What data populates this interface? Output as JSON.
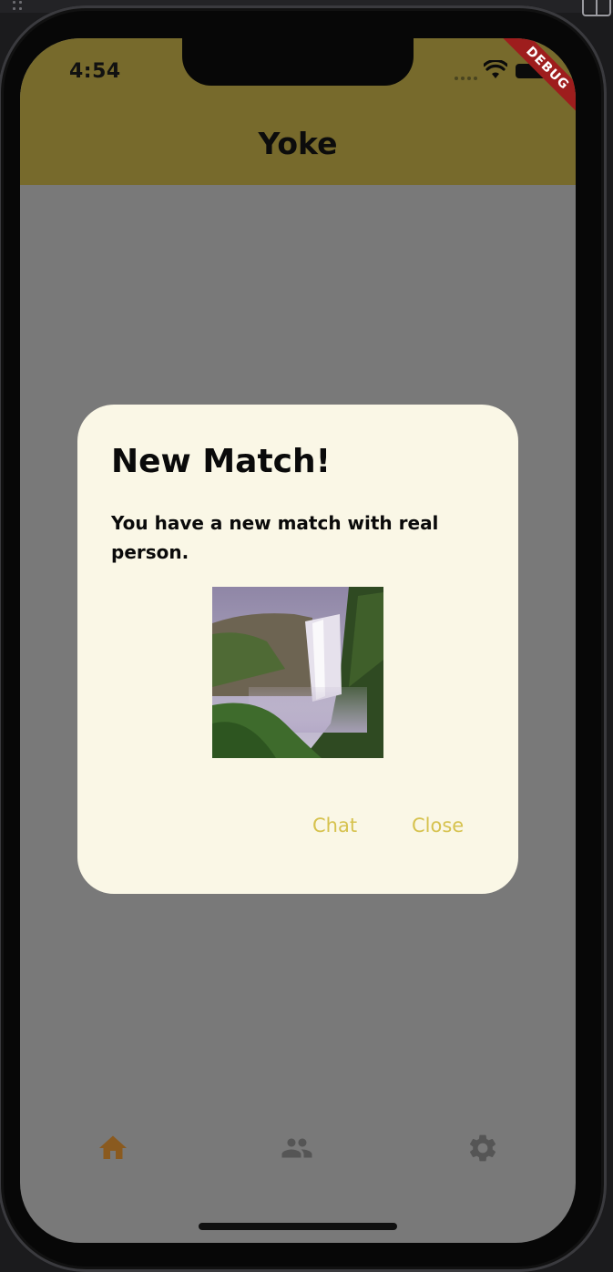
{
  "status_bar": {
    "time": "4:54",
    "debug_label": "DEBUG"
  },
  "app_bar": {
    "title": "Yoke"
  },
  "dialog": {
    "title": "New Match!",
    "message": "You have a new match with real person.",
    "image_icon": "waterfall-photo",
    "buttons": {
      "chat": "Chat",
      "close": "Close"
    }
  },
  "bottom_nav": {
    "items": [
      {
        "icon": "home-icon",
        "selected": true
      },
      {
        "icon": "people-icon",
        "selected": false
      },
      {
        "icon": "gear-icon",
        "selected": false
      }
    ]
  },
  "colors": {
    "app_bar": "#776a2c",
    "scrim": "#797979",
    "dialog_background": "#faf7e6",
    "button_text": "#d6c24e",
    "nav_selected": "#8a5a1f",
    "nav_unselected": "#555555",
    "debug_ribbon": "#9e1d1d"
  }
}
